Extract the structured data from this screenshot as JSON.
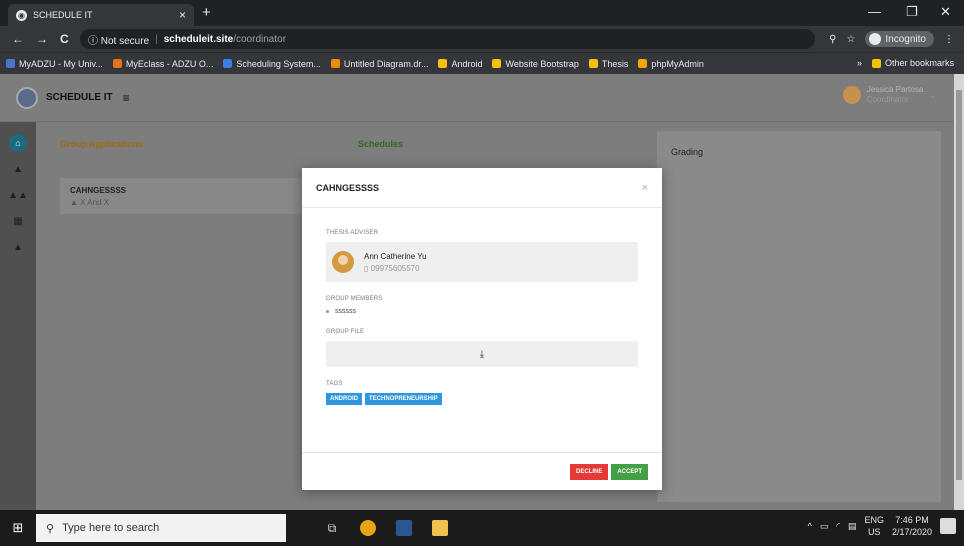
{
  "browser": {
    "tab_title": "SCHEDULE IT",
    "tab_close": "×",
    "new_tab": "+",
    "win_min": "—",
    "win_max": "❐",
    "win_close": "✕",
    "back": "←",
    "forward": "→",
    "reload": "C",
    "security": "ⓘ Not secure",
    "url_domain": "scheduleit.site",
    "url_path": "/coordinator",
    "incognito": "Incognito",
    "bookmarks": [
      {
        "label": "MyADZU - My Univ...",
        "color": "#4a74c9"
      },
      {
        "label": "MyEclass - ADZU O...",
        "color": "#e8711c"
      },
      {
        "label": "Scheduling System...",
        "color": "#3d7ee6"
      },
      {
        "label": "Untitled Diagram.dr...",
        "color": "#f08c00"
      },
      {
        "label": "Android",
        "color": "#f4c20d"
      },
      {
        "label": "Website Bootstrap",
        "color": "#f4c20d"
      },
      {
        "label": "Thesis",
        "color": "#f4c20d"
      },
      {
        "label": "phpMyAdmin",
        "color": "#f0a500"
      }
    ],
    "more_bookmarks": "»",
    "other_bookmarks": "Other bookmarks"
  },
  "app": {
    "brand": "SCHEDULE IT",
    "menu_icon": "≡",
    "user_name": "Jessica Partosa",
    "user_role": "Coordinator",
    "col_group_apps": "Group Applications",
    "col_schedules": "Schedules",
    "group_app_color": "#e09a20",
    "schedules_color": "#3f8a2a",
    "group_card_title": "CAHNGESSSS",
    "group_card_sub": "X And X",
    "grading_title": "Grading"
  },
  "modal": {
    "title": "CAHNGESSSS",
    "close": "×",
    "adviser_label": "THESIS ADVISER",
    "adviser_name": "Ann Catherine Yu",
    "adviser_phone": "09975605570",
    "members_label": "GROUP MEMBERS",
    "members": [
      "ssssss"
    ],
    "file_label": "GROUP FILE",
    "download_icon": "⤓",
    "tags_label": "TAGS",
    "tags": [
      "ANDROID",
      "TECHNOPRENEURSHIP"
    ],
    "decline_label": "DECLINE",
    "accept_label": "ACCEPT"
  },
  "taskbar": {
    "search_placeholder": "Type here to search",
    "lang_top": "ENG",
    "lang_bottom": "US",
    "time": "7:46 PM",
    "date": "2/17/2020"
  }
}
